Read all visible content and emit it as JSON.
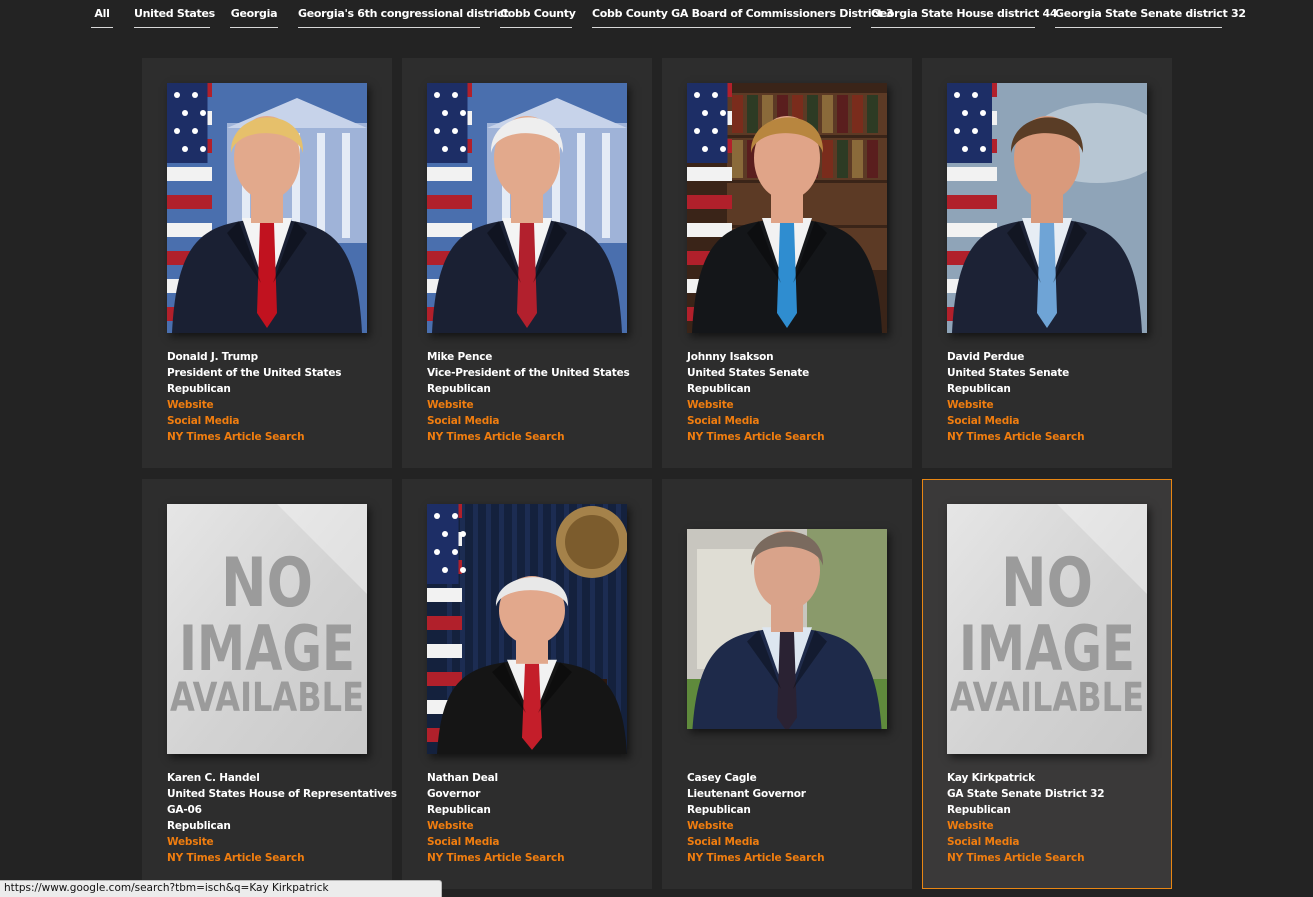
{
  "filters": [
    {
      "label": "All"
    },
    {
      "label": "United States"
    },
    {
      "label": "Georgia"
    },
    {
      "label": "Georgia's 6th congressional district"
    },
    {
      "label": "Cobb County"
    },
    {
      "label": "Cobb County GA Board of Commissioners District 3"
    },
    {
      "label": "Georgia State House district 44"
    },
    {
      "label": "Georgia State Senate district 32"
    }
  ],
  "cards": [
    {
      "name": "Donald J. Trump",
      "office": "President of the United States",
      "district": "",
      "party": "Republican",
      "website": "Website",
      "social": "Social Media",
      "news": "NY Times Article Search",
      "photo": "portrait-whitehouse",
      "selected": false
    },
    {
      "name": "Mike Pence",
      "office": "Vice-President of the United States",
      "district": "",
      "party": "Republican",
      "website": "Website",
      "social": "Social Media",
      "news": "NY Times Article Search",
      "photo": "portrait-whitehouse",
      "selected": false
    },
    {
      "name": "Johnny Isakson",
      "office": "United States Senate",
      "district": "",
      "party": "Republican",
      "website": "Website",
      "social": "Social Media",
      "news": "NY Times Article Search",
      "photo": "portrait-bookshelf",
      "selected": false
    },
    {
      "name": "David Perdue",
      "office": "United States Senate",
      "district": "",
      "party": "Republican",
      "website": "Website",
      "social": "Social Media",
      "news": "NY Times Article Search",
      "photo": "portrait-sky",
      "selected": false
    },
    {
      "name": "Karen C. Handel",
      "office": "United States House of Representatives",
      "district": "GA-06",
      "party": "Republican",
      "website": "Website",
      "social": "",
      "news": "NY Times Article Search",
      "photo": "no-image",
      "selected": false
    },
    {
      "name": "Nathan Deal",
      "office": "Governor",
      "district": "",
      "party": "Republican",
      "website": "Website",
      "social": "Social Media",
      "news": "NY Times Article Search",
      "photo": "portrait-seated-seal",
      "selected": false
    },
    {
      "name": "Casey Cagle",
      "office": "Lieutenant Governor",
      "district": "",
      "party": "Republican",
      "website": "Website",
      "social": "Social Media",
      "news": "NY Times Article Search",
      "photo": "portrait-outdoor",
      "selected": false
    },
    {
      "name": "Kay Kirkpatrick",
      "office": "GA State Senate District 32",
      "district": "",
      "party": "Republican",
      "website": "Website",
      "social": "Social Media",
      "news": "NY Times Article Search",
      "photo": "no-image",
      "selected": true
    }
  ],
  "no_image": {
    "line1": "NO",
    "line2": "IMAGE",
    "line3": "AVAILABLE"
  },
  "status_url": "https://www.google.com/search?tbm=isch&q=Kay Kirkpatrick",
  "colors": {
    "background": "#232323",
    "card": "#2d2d2d",
    "link": "#f07d0f",
    "selected_border": "#e88613"
  }
}
